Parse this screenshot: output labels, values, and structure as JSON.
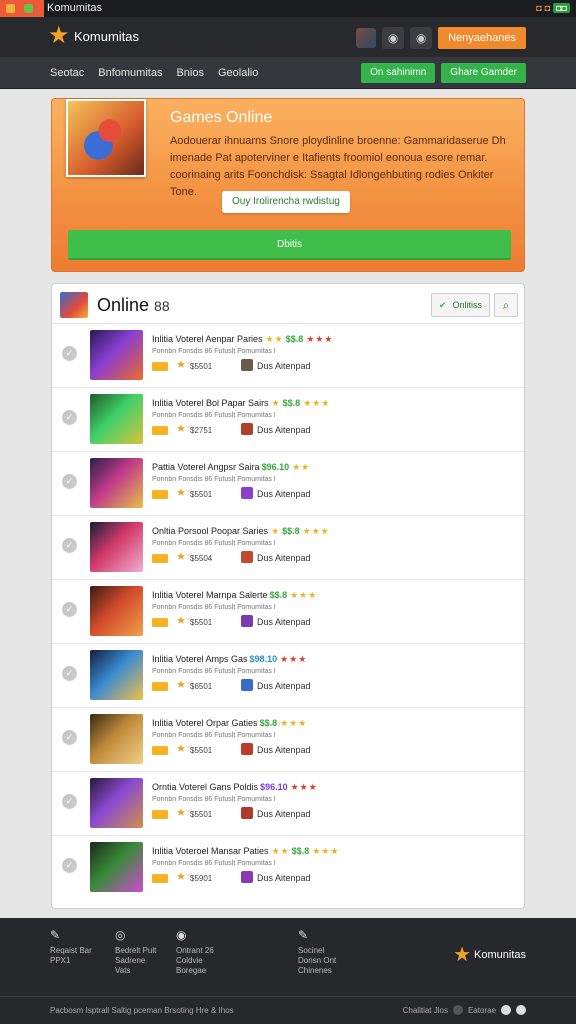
{
  "tab": {
    "title": "Komumitas"
  },
  "header": {
    "brand": "Komumitas",
    "cta": "Nenyaehanes"
  },
  "nav": {
    "links": [
      "Seotac",
      "Bnfomumitas",
      "Bnios",
      "Geolalio"
    ],
    "buttons": [
      "On sahinimn",
      "Ghare Gamder"
    ]
  },
  "promo": {
    "title": "Games Online",
    "description": "Aodouerar ihnuarns Snore ploydinline broenne: Gammaridaserue Dh imenade Pat apoterviner e Itafients froomiol eonoua esore remar. coorinaing arits Foonchdisk: Ssagtal Idlongehbuting rodies Onkiter Tone.",
    "pill": "Ouy Irolirencha rwdistug",
    "cta": "Dbitis"
  },
  "list": {
    "title": "Online",
    "count": "88",
    "filter_label": "Onlitiss",
    "rows": [
      {
        "title": "Inlitia Voterel Aenpar Paries",
        "score": "$$.8",
        "meta": "Ponnbn Fonsdis 86 Futuslt Fomumitas I",
        "num": "$5501",
        "who": "Dus Aitenpad"
      },
      {
        "title": "Inlitia Voterel Bol Papar Sairs",
        "score": "$$.8",
        "meta": "Ponnbn Fonsdis 86 Futuslt Fomumitas I",
        "num": "$2751",
        "who": "Dus Aitenpad"
      },
      {
        "title": "Pattia Voterel Angpsr Saira",
        "score": "$96.10",
        "meta": "Ponnbn Fonsdis 86 Futuslt Fomumitas I",
        "num": "$5501",
        "who": "Dus Aitenpad"
      },
      {
        "title": "Onltia Porsool Poopar Saries",
        "score": "$$.8",
        "meta": "Ponnbn Fonsdis 86 Futuslt Fomumitas I",
        "num": "$5504",
        "who": "Dus Aitenpad"
      },
      {
        "title": "Inlitia Voterel Marnpa Salerte",
        "score": "$$.8",
        "meta": "Ponnbn Fonsdis 86 Futuslt Fomumitas I",
        "num": "$5501",
        "who": "Dus Aitenpad"
      },
      {
        "title": "Inlitia Voterel Amps Gas",
        "score": "$98.10",
        "meta": "Ponnbn Fonsdis 86 Futuslt Fomumitas I",
        "num": "$6501",
        "who": "Dus Aitenpad"
      },
      {
        "title": "Inlitia Voterel Orpar Gaties",
        "score": "$$.8",
        "meta": "Ponnbn Fonsdis 86 Futuslt Fomumitas I",
        "num": "$5501",
        "who": "Dus Aitenpad"
      },
      {
        "title": "Orntia Voterel Gans Poldis",
        "score": "$96.10",
        "meta": "Ponnbn Fonsdis 86 Futuslt Fomumitas I",
        "num": "$5501",
        "who": "Dus Aitenpad"
      },
      {
        "title": "Inlitia Voteroel Mansar Paties",
        "score": "$$.8",
        "meta": "Ponnbn Fonsdis 86 Futuslt Fomumitas I",
        "num": "$5901",
        "who": "Dus Aitenpad"
      }
    ]
  },
  "footer": {
    "cols": [
      {
        "icon": "chat-icon",
        "lines": [
          "Reqaist Bar",
          "PPX1"
        ]
      },
      {
        "icon": "gamepad-icon",
        "lines": [
          "Bedrelt Pult",
          "Sadrene",
          "Vats"
        ]
      },
      {
        "icon": "people-icon",
        "lines": [
          "Ontrant 26",
          "Coldvie",
          "Boregae"
        ]
      },
      {
        "icon": "megaphone-icon",
        "lines": [
          "Socinel",
          "Donsn Ont",
          "Chinenes"
        ]
      }
    ],
    "brand": "Komunitas",
    "copyright": "Pacbosm Isptrall Saltig pceman Brsoting Hre & Ihos",
    "bottom_right": [
      "Chalitiat Jlos",
      "Eatorae"
    ]
  },
  "colors": {
    "orange": "#f08a2c",
    "green": "#33b349",
    "dark": "#27292d"
  }
}
